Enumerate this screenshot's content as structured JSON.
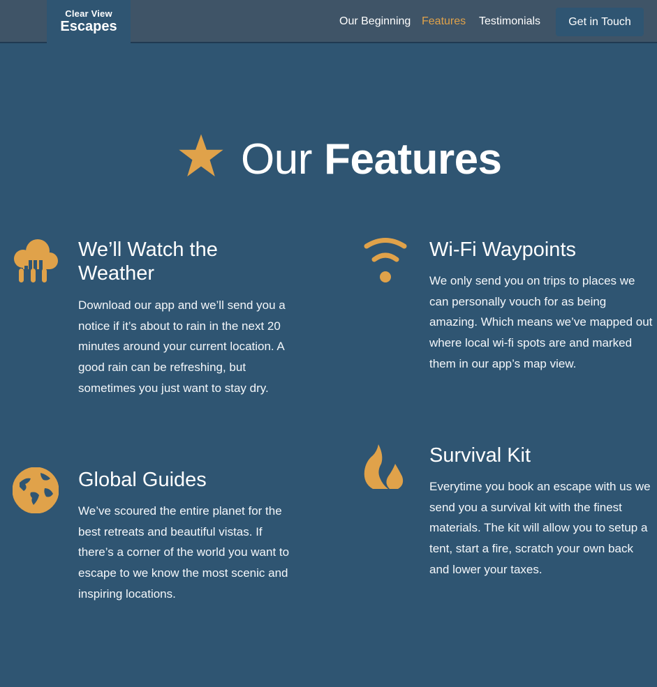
{
  "brand": {
    "line1": "Clear View",
    "line2": "Escapes"
  },
  "nav": {
    "items": [
      {
        "label": "Our Beginning"
      },
      {
        "label": "Features"
      },
      {
        "label": "Testimonials"
      }
    ],
    "active": "Features",
    "cta": "Get in Touch"
  },
  "section": {
    "title_light": "Our",
    "title_bold": "Features",
    "icon": "star-icon"
  },
  "features": [
    {
      "icon": "rain-cloud-icon",
      "title": "We’ll Watch the Weather",
      "body": "Download our app and we’ll send you a notice if it’s about to rain in the next 20 minutes around your current location. A good rain can be refreshing, but sometimes you just want to stay dry."
    },
    {
      "icon": "wifi-icon",
      "title": "Wi-Fi Waypoints",
      "body": "We only send you on trips to places we can personally vouch for as being amazing. Which means we’ve mapped out where local wi-fi spots are and marked them in our app’s map view."
    },
    {
      "icon": "globe-icon",
      "title": "Global Guides",
      "body": "We’ve scoured the entire planet for the best retreats and beautiful vistas. If there’s a corner of the world you want to escape to we know the most scenic and inspiring locations."
    },
    {
      "icon": "fire-icon",
      "title": "Survival Kit",
      "body": "Everytime you book an escape with us we send you a survival kit with the finest materials. The kit will allow you to setup a tent, start a fire, scratch your own back and lower your taxes."
    }
  ],
  "colors": {
    "background": "#2f5572",
    "navbar": "#3f5467",
    "accent": "#e0a24a",
    "text": "#ffffff"
  }
}
